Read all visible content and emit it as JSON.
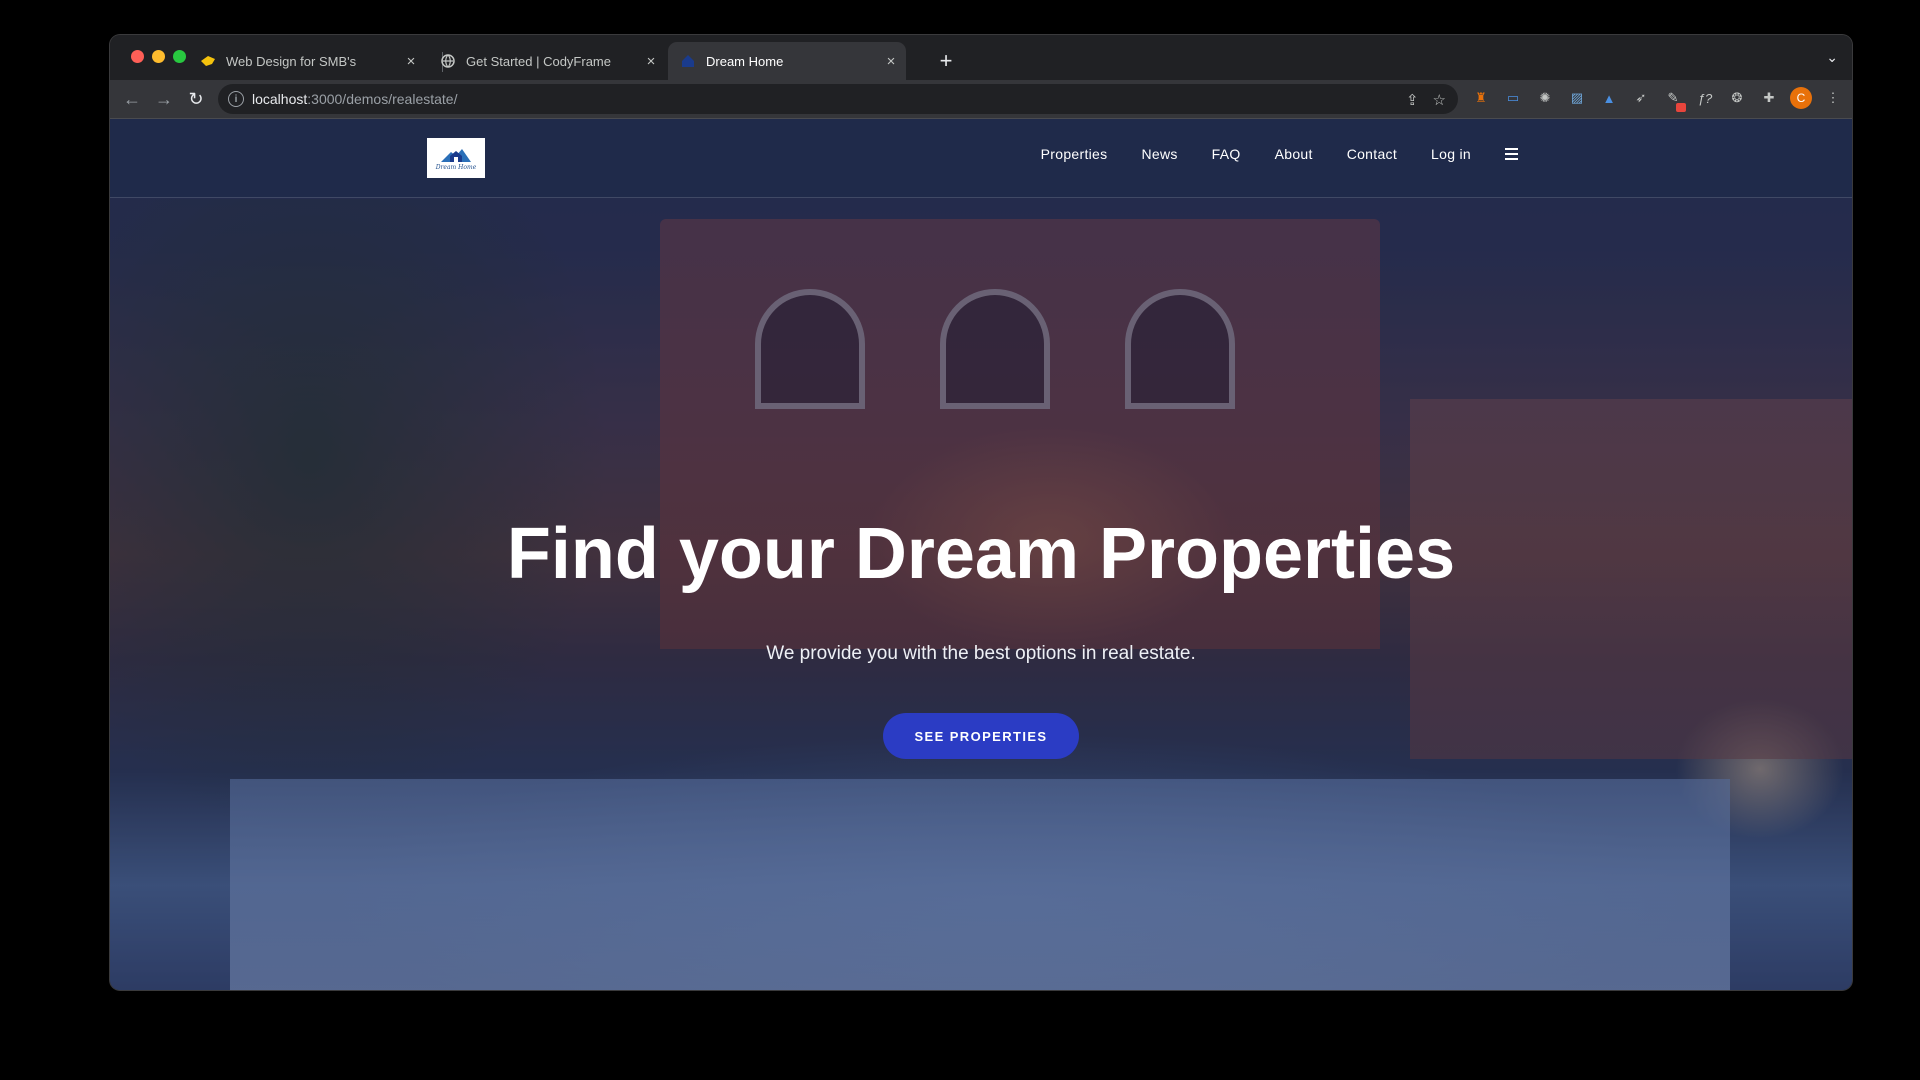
{
  "browser": {
    "tabs": [
      {
        "title": "Web Design for SMB's",
        "icon": "smb-favicon-icon"
      },
      {
        "title": "Get Started | CodyFrame",
        "icon": "globe-icon"
      },
      {
        "title": "Dream Home",
        "icon": "house-favicon-icon"
      }
    ],
    "active_tab": 2,
    "new_tab_label": "+",
    "address": {
      "host": "localhost",
      "path": ":3000/demos/realestate/"
    },
    "profile_initial": "C"
  },
  "site": {
    "logo_text": "Dream Home",
    "nav": [
      "Properties",
      "News",
      "FAQ",
      "About",
      "Contact",
      "Log in"
    ],
    "hero": {
      "title": "Find your Dream Properties",
      "subtitle": "We provide you with the best options in real estate.",
      "cta": "SEE PROPERTIES"
    }
  },
  "colors": {
    "cta": "#2b3cc4",
    "header": "#1f2a4a",
    "chrome": "#35363a"
  }
}
